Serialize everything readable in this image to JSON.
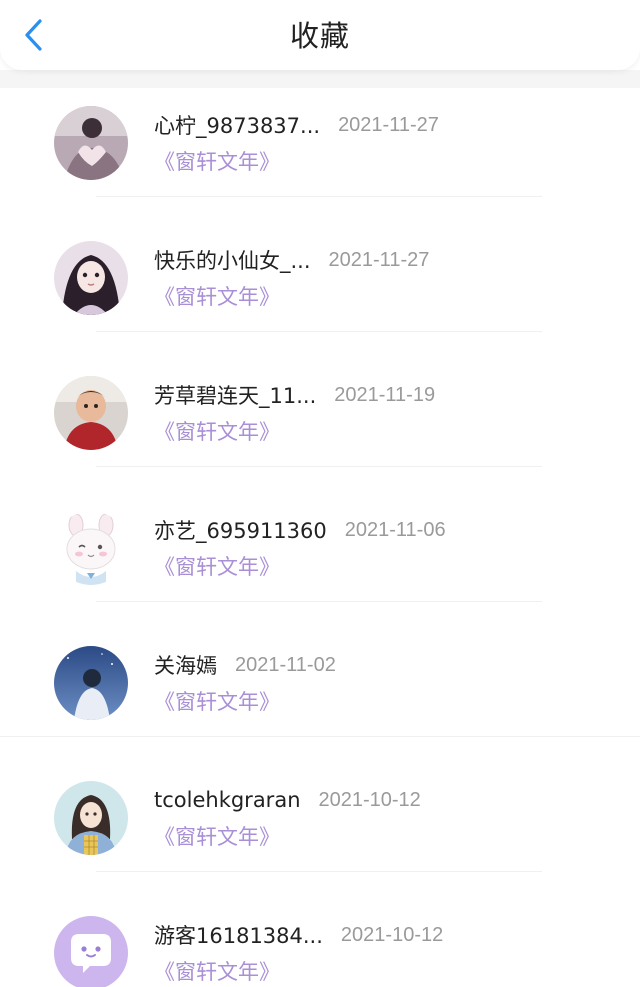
{
  "header": {
    "title": "收藏",
    "back_icon": "back-arrow-icon",
    "accent": "#2a8ff0"
  },
  "list": {
    "items": [
      {
        "name": "心柠_9873837...",
        "date": "2021-11-27",
        "book": "《窗轩文年》",
        "avatar": "avatar-photo-heart-hands"
      },
      {
        "name": "快乐的小仙女_...",
        "date": "2021-11-27",
        "book": "《窗轩文年》",
        "avatar": "avatar-photo-girl"
      },
      {
        "name": "芳草碧连天_11...",
        "date": "2021-11-19",
        "book": "《窗轩文年》",
        "avatar": "avatar-photo-baby"
      },
      {
        "name": "亦艺_695911360",
        "date": "2021-11-06",
        "book": "《窗轩文年》",
        "avatar": "avatar-cartoon-bunny"
      },
      {
        "name": "关海嫣",
        "date": "2021-11-02",
        "book": "《窗轩文年》",
        "avatar": "avatar-photo-night-sky"
      },
      {
        "name": "tcolehkgraran",
        "date": "2021-10-12",
        "book": "《窗轩文年》",
        "avatar": "avatar-illustration-girl"
      },
      {
        "name": "游客16181384...",
        "date": "2021-10-12",
        "book": "《窗轩文年》",
        "avatar": "avatar-default-chat-bubble"
      }
    ]
  },
  "colors": {
    "book_title": "#a98fd6",
    "date": "#9a9a9a",
    "name": "#222222"
  }
}
